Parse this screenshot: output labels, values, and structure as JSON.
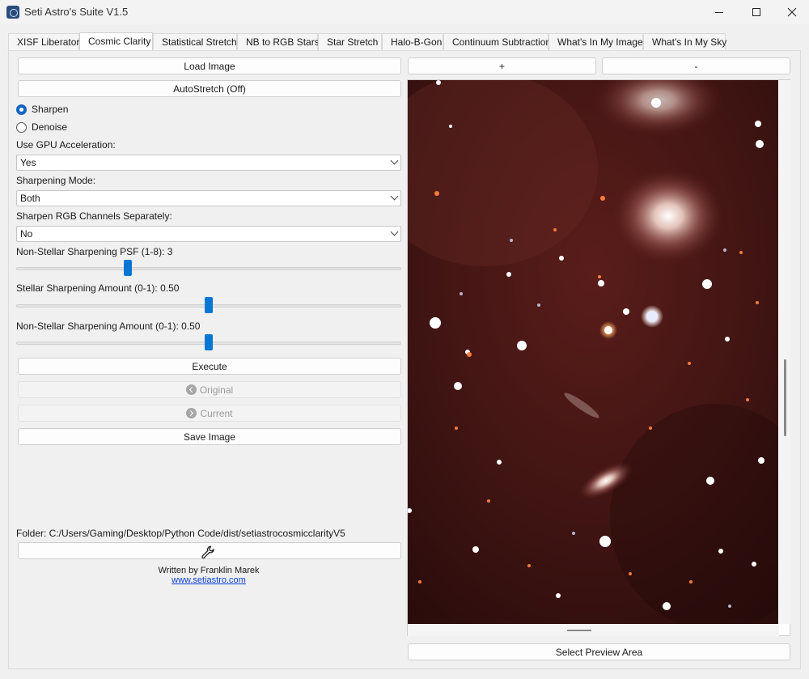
{
  "window": {
    "title": "Seti Astro's Suite V1.5"
  },
  "tabs": [
    {
      "label": "XISF Liberator"
    },
    {
      "label": "Cosmic Clarity",
      "active": true
    },
    {
      "label": "Statistical Stretch"
    },
    {
      "label": "NB to RGB Stars"
    },
    {
      "label": "Star Stretch"
    },
    {
      "label": "Halo-B-Gon"
    },
    {
      "label": "Continuum Subtraction"
    },
    {
      "label": "What's In My Image"
    },
    {
      "label": "What's In My Sky"
    }
  ],
  "controls": {
    "load_image": "Load Image",
    "autostretch": "AutoStretch (Off)",
    "mode_sharpen": "Sharpen",
    "mode_denoise": "Denoise",
    "selected_mode": "Sharpen",
    "gpu_label": "Use GPU Acceleration:",
    "gpu_value": "Yes",
    "sharpen_mode_label": "Sharpening Mode:",
    "sharpen_mode_value": "Both",
    "rgb_sep_label": "Sharpen RGB Channels Separately:",
    "rgb_sep_value": "No",
    "psf_label": "Non-Stellar Sharpening PSF (1-8): 3",
    "psf_value": 3,
    "psf_min": 1,
    "psf_max": 8,
    "stellar_label": "Stellar Sharpening Amount (0-1): 0.50",
    "stellar_value": 0.5,
    "nonstellar_label": "Non-Stellar Sharpening Amount (0-1): 0.50",
    "nonstellar_value": 0.5,
    "execute": "Execute",
    "original": "Original",
    "current": "Current",
    "save_image": "Save Image",
    "folder_label": "Folder: C:/Users/Gaming/Desktop/Python Code/dist/setiastrocosmicclarityV5",
    "settings_icon": "wrench-icon",
    "credit": "Written by Franklin Marek",
    "website": "www.setiastro.com"
  },
  "preview": {
    "zoom_in": "+",
    "zoom_out": "-",
    "select_area": "Select Preview Area"
  },
  "colors": {
    "accent": "#0a76d3",
    "link": "#0b3fd0",
    "image_bg": "#3b1312"
  }
}
